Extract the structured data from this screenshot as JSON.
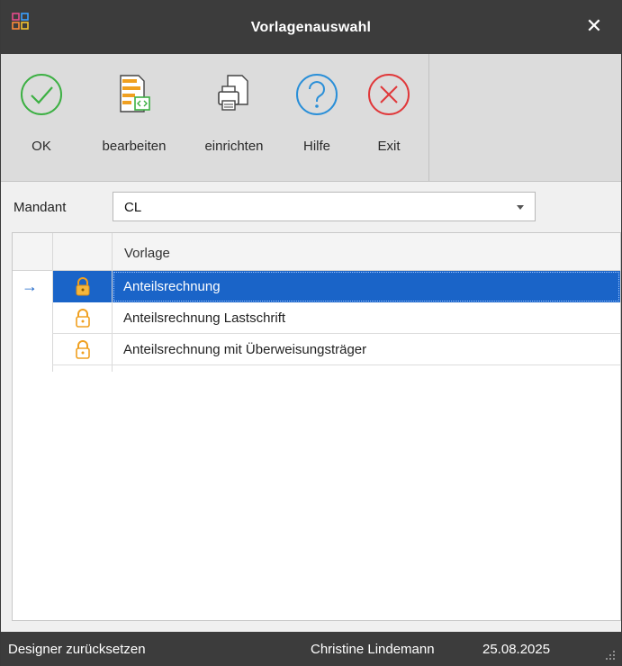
{
  "window": {
    "title": "Vorlagenauswahl"
  },
  "toolbar": {
    "ok_label": "OK",
    "edit_label": "bearbeiten",
    "setup_label": "einrichten",
    "help_label": "Hilfe",
    "exit_label": "Exit"
  },
  "mandant": {
    "label": "Mandant",
    "value": "CL"
  },
  "grid": {
    "column_header": "Vorlage",
    "rows": [
      {
        "name": "Anteilsrechnung",
        "selected": true
      },
      {
        "name": "Anteilsrechnung Lastschrift",
        "selected": false
      },
      {
        "name": "Anteilsrechnung mit Überweisungsträger",
        "selected": false
      }
    ]
  },
  "status": {
    "reset_label": "Designer zurücksetzen",
    "user": "Christine Lindemann",
    "date": "25.08.2025"
  },
  "colors": {
    "titlebar": "#3c3c3c",
    "selection": "#1a64c8",
    "ok_green": "#3cb043",
    "help_blue": "#2a8fd8",
    "exit_red": "#e0383a",
    "lock_orange": "#f0a020"
  },
  "icons": {
    "app": "app-grid-icon",
    "close": "close-icon",
    "ok": "check-circle-icon",
    "edit": "edit-document-icon",
    "setup": "printer-document-icon",
    "help": "question-circle-icon",
    "exit": "x-circle-icon",
    "row_indicator": "arrow-right-icon",
    "lock": "lock-icon"
  }
}
